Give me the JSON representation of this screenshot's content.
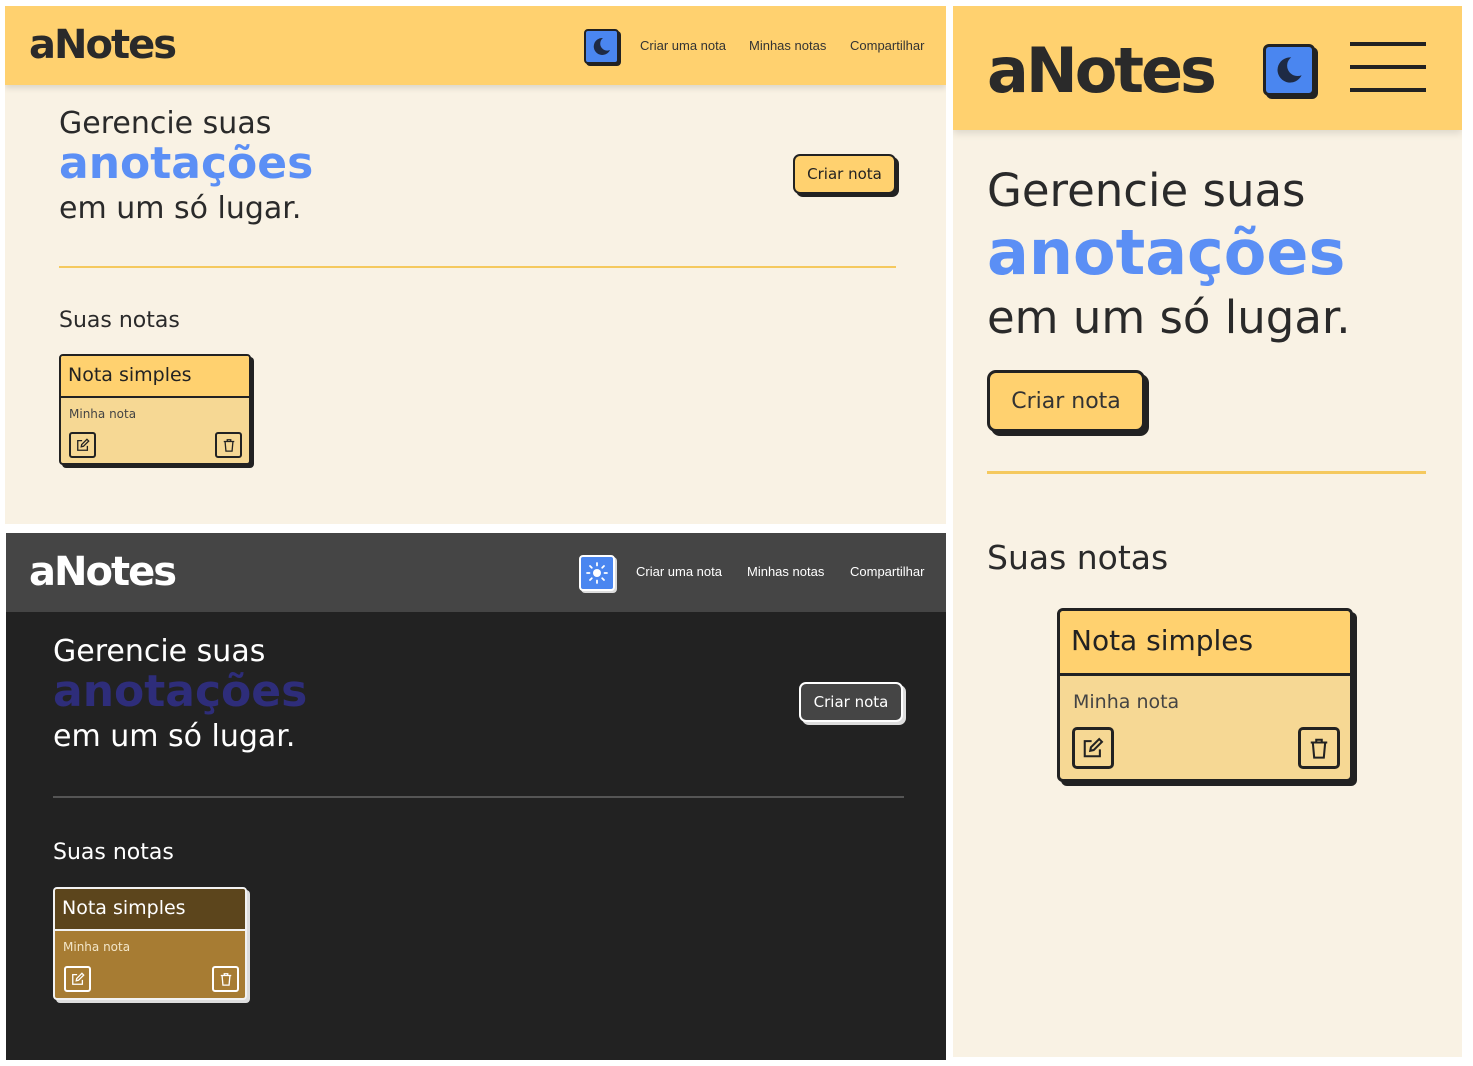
{
  "app": {
    "logo": "aNotes"
  },
  "nav": {
    "create": "Criar uma nota",
    "my_notes": "Minhas notas",
    "share": "Compartilhar"
  },
  "hero": {
    "line1": "Gerencie suas",
    "accent": "anotações",
    "line3": "em um só lugar.",
    "cta": "Criar nota"
  },
  "notes": {
    "section_title": "Suas notas",
    "items": [
      {
        "title": "Nota simples",
        "content": "Minha nota"
      }
    ]
  },
  "icons": {
    "dark_mode": "moon-icon",
    "light_mode": "sun-icon",
    "menu": "hamburger-menu-icon",
    "edit": "edit-icon",
    "delete": "trash-icon"
  },
  "colors": {
    "light_background": "#f9f2e4",
    "header_yellow": "#ffd16f",
    "accent_blue": "#5b8ff5",
    "dark_background": "#222222",
    "dark_header": "#454545",
    "dark_accent": "#2e2d7a",
    "note_body_light": "#f6d894",
    "note_head_dark": "#5c451c",
    "note_body_dark": "#a77c33",
    "toggle_blue": "#4a86f0"
  }
}
